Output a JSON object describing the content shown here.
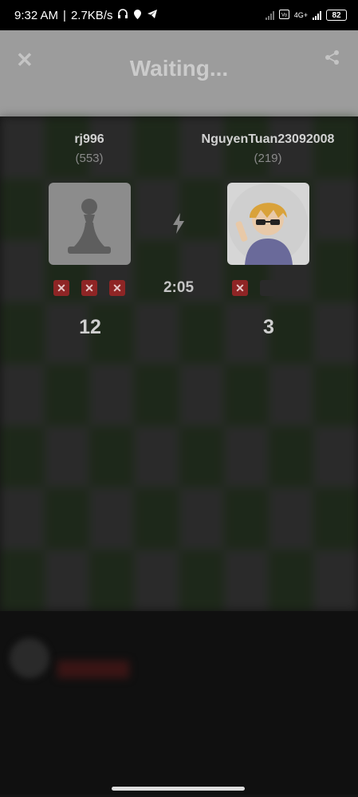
{
  "status_bar": {
    "time": "9:32 AM",
    "separator": "|",
    "speed": "2.7KB/s",
    "network": "4G+",
    "battery": "82"
  },
  "header": {
    "title": "Waiting..."
  },
  "game": {
    "timer": "2:05",
    "left_player": {
      "name": "rj996",
      "rating": "(553)",
      "score": "12",
      "results": [
        "loss",
        "loss",
        "loss"
      ]
    },
    "right_player": {
      "name": "NguyenTuan23092008",
      "rating": "(219)",
      "score": "3",
      "results": [
        "loss",
        "empty",
        "empty"
      ]
    }
  },
  "colors": {
    "header_bg": "#9c9c9c",
    "loss_badge": "#8e2525",
    "board_dark": "#263a1f"
  },
  "icons": {
    "close": "close-icon",
    "share": "share-icon",
    "game_mode": "lightning-bolt-icon"
  }
}
